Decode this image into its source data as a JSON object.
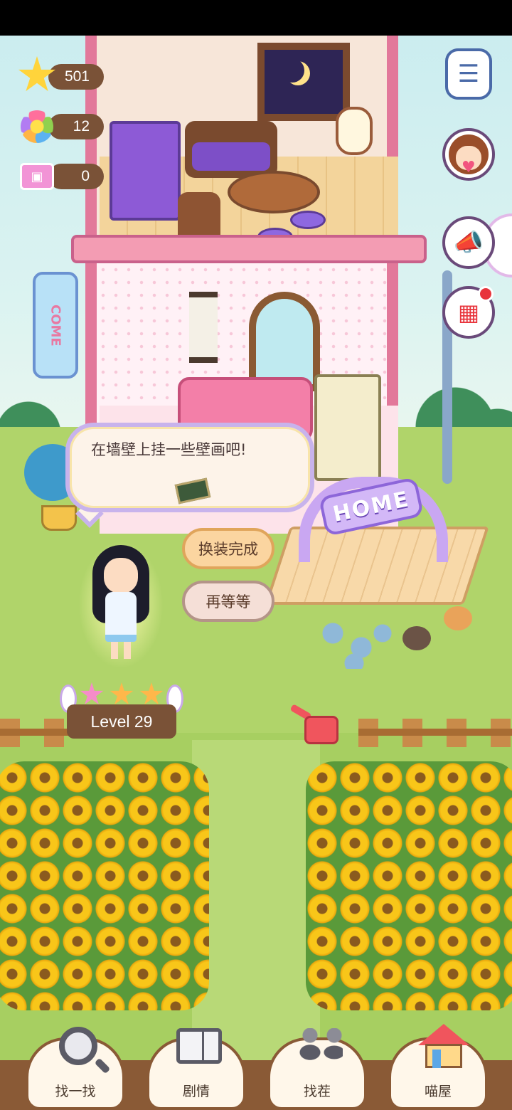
{
  "hud": {
    "stars": "501",
    "flowers": "12",
    "tickets": "0"
  },
  "signs": {
    "home": "HOME",
    "come": "COME"
  },
  "dialog": {
    "text": "在墙壁上挂一些壁画吧!"
  },
  "choices": {
    "confirm": "换装完成",
    "wait": "再等等"
  },
  "level": {
    "label": "Level 29",
    "stars_filled": 3
  },
  "side_buttons": [
    {
      "icon": "notebook-icon"
    },
    {
      "icon": "character-avatar-icon"
    },
    {
      "icon": "megaphone-icon"
    },
    {
      "icon": "calendar-icon",
      "badge": true
    }
  ],
  "bottom_nav": [
    {
      "label": "找一找",
      "icon": "magnifier-icon"
    },
    {
      "label": "剧情",
      "icon": "book-icon"
    },
    {
      "label": "找茬",
      "icon": "flower-pots-icon"
    },
    {
      "label": "喵屋",
      "icon": "house-icon"
    }
  ],
  "colors": {
    "wood": "#7a5237",
    "accent_purple": "#c8b3ec",
    "grass": "#a7cf61",
    "sunflower": "#f8c619"
  }
}
